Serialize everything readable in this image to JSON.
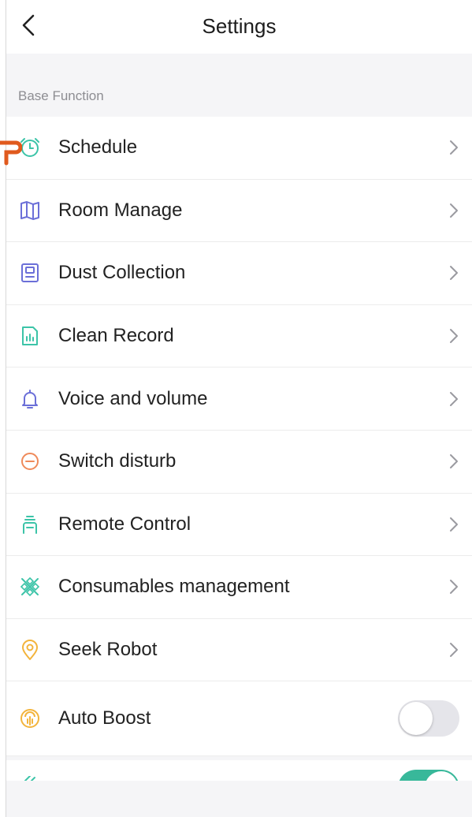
{
  "header": {
    "title": "Settings"
  },
  "section": {
    "label": "Base Function"
  },
  "items": [
    {
      "label": "Schedule",
      "icon": "alarm-clock-icon",
      "color": "#3cc4a8"
    },
    {
      "label": "Room Manage",
      "icon": "map-icon",
      "color": "#6b6fd8"
    },
    {
      "label": "Dust Collection",
      "icon": "dust-bin-icon",
      "color": "#6b6fd8"
    },
    {
      "label": "Clean Record",
      "icon": "report-icon",
      "color": "#3cc4a8"
    },
    {
      "label": "Voice and volume",
      "icon": "bell-icon",
      "color": "#6b6fd8"
    },
    {
      "label": "Switch disturb",
      "icon": "minus-circle-icon",
      "color": "#ef8a5a"
    },
    {
      "label": "Remote Control",
      "icon": "remote-icon",
      "color": "#3cc4a8"
    },
    {
      "label": "Consumables management",
      "icon": "consumables-icon",
      "color": "#3cc4a8"
    },
    {
      "label": "Seek Robot",
      "icon": "location-pin-icon",
      "color": "#f3b43c"
    }
  ],
  "toggle_item": {
    "label": "Auto Boost",
    "icon": "fan-icon",
    "color": "#f3b43c",
    "on": false
  },
  "partial_toggle": {
    "on": true,
    "color": "#38b89a"
  },
  "colors": {
    "chevron": "#9a9aa0",
    "accent": "#38b89a",
    "callout": "#e05a1e"
  }
}
